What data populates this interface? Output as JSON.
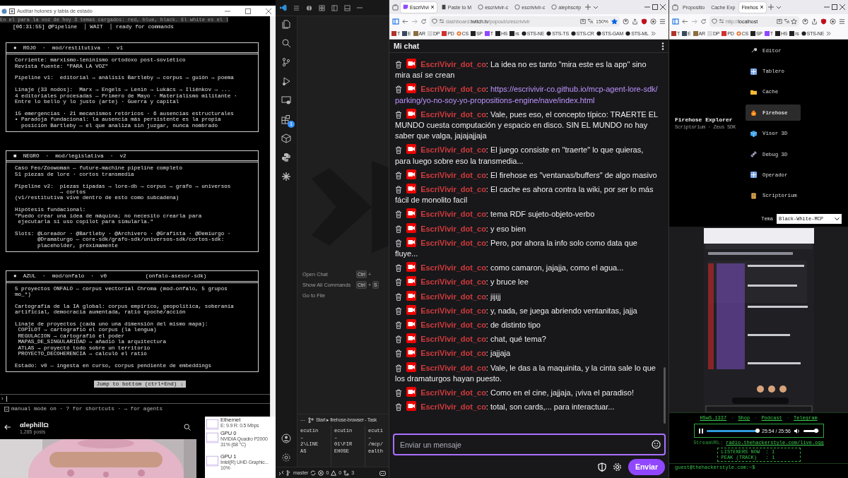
{
  "terminal_window": {
    "title": "Auditar holones y tabla de estado",
    "faded_line": "En el para la voz de hoy 3 temas cargados: red, blue, black. El white es el l",
    "status_line": "[06:31:55] @Pipeline  │ WAIT  │ ready for commands",
    "boxes": [
      {
        "header": "●  ROJO  ·  mod/restitutiva  ·  v1",
        "paragraphs": [
          "Corriente: marxismo-leninismo ortodoxo post-soviético\nRevista fuente: \"PARA LA VOZ\"",
          "Pipeline v1:  editorial → análisis Bartleby → corpus → guión → poema",
          "Linaje (33 nodos):  Marx → Engels → Lenin → Lukács → Iliénkov → ...\n4 editoriales procesadas — Primero de Mayo · Materialismo militante ·\nEntre lo bello y lo justo (arte) · Guerra y capital",
          "15 emergencias · 21 mecanismos retóricos · 6 ausencias estructurales\n▪ Paradoja fundacional: la ausencia más persistente es la propia\n  posición Bartleby — el que analiza sin juzgar, nunca nombrado"
        ]
      },
      {
        "header": "■  NEGRO  ·  mod/legislativa  ·  v2",
        "paragraphs": [
          "Caso Feo/Zoowoman — future-machine pipeline completo\n51 piezas de lore · cortos transmedia",
          "Pipeline v2:  piezas tipadas → lore-db → corpus → grafo → universos\n              → cortos\n(v1/restitutiva vive dentro de esto como subcadena)",
          "Hipótesis fundacional:\n\"Puedo crear una idea de máquina; no necesito crearla para\n ejecutarla si uso copilot para simularla.\"",
          "Slots: @Loreador · @Bartleby · @Archivero · @Grafista · @Demiurgo ·\n       @Dramaturgo — core-sdk/grafo-sdk/universos-sdk/cortos-sdk:\n       placeholder, próximamente"
        ]
      },
      {
        "header": "●  AZUL  ·  mod/onfalo  ·  v0            (onfalo-asesor-sdk)",
        "paragraphs": [
          "5 proyectos ONFALO — corpus vectorial Chroma (mod-onfalo, 5 grupos\nmo_*)",
          "Cartografía de la IA global: corpus empírico, geopolítica, soberanía\nartificial, democracia aumentada, ratio epoché/acción",
          "Linaje de proyectos (cada uno una dimensión del mismo mapa):\n COPILOT → cartografió el corpus (la lengua)\n REGULACION → cartografió el poder\n MAPAS_DE_SINGULARIDAD → añadió la arquitectura\n ATLAS → proyectó todo sobre un territorio\n PROYECTO_DECOHERENCIA → calculó el ratio",
          "Estado: v0 — ingesta en curso, corpus pendiente de embeddings"
        ]
      }
    ],
    "jump_button": "Jump to bottom (ctrl+End) ↓",
    "prompt": "›",
    "footer": "manual mode on · ? for shortcuts · → for agents"
  },
  "social_panel": {
    "name": "αlephillΩ",
    "posts": "1,285 posts",
    "photo": {
      "kind": "picture"
    }
  },
  "task_manager": [
    {
      "name": "Ethernet",
      "detail": "E: 9.9 R: 0.5 Mbps"
    },
    {
      "name": "GPU 0",
      "detail": "NVIDIA Quadro P2000",
      "reading": "31% (68 °C)"
    },
    {
      "name": "GPU 1",
      "detail": "Intel(R) UHD Graphic...",
      "reading": "10%"
    }
  ],
  "code_editor": {
    "extensions_badge": "1",
    "commands": [
      {
        "label": "Open Chat",
        "keys": [
          {
            "kind": "cap",
            "text": "Ctrl"
          },
          {
            "kind": "plus",
            "text": "+"
          }
        ]
      },
      {
        "label": "Show All Commands",
        "keys": [
          {
            "kind": "cap",
            "text": "Ctrl"
          },
          {
            "kind": "plus",
            "text": "+"
          },
          {
            "kind": "cap",
            "text": "S"
          }
        ]
      },
      {
        "label": "Go to File"
      }
    ],
    "panel": {
      "more": "···",
      "breadcrumb": "Start ▸ firehose-browser - Task"
    },
    "terminals": [
      {
        "lines": [
          "ecutin",
          "–",
          "2\\LINE",
          "AS"
        ]
      },
      {
        "lines": [
          "ecutin",
          "–",
          "01\\FIR",
          "EHOSE"
        ]
      },
      {
        "lines": [
          "ecuti",
          "–",
          "/mcp/",
          "ealth"
        ]
      }
    ],
    "status_bar": {
      "branch": "master",
      "errors": "0",
      "warnings": "0",
      "ports": "3"
    }
  },
  "chat_browser": {
    "tabs": [
      {
        "label": "EscriVivi",
        "kind": "twitch",
        "selected": true
      },
      {
        "label": "Paste to M",
        "kind": "page",
        "selected": false
      },
      {
        "label": "escrivivir-c",
        "kind": "github",
        "selected": false
      },
      {
        "label": "escrivivir-c",
        "kind": "github",
        "selected": false
      },
      {
        "label": "alephscrip",
        "kind": "github",
        "selected": false
      }
    ],
    "url": {
      "pre": "dashboard.",
      "host": "twitch.tv",
      "path": "/popout/u/escrivivir"
    },
    "zoom": "150%",
    "bookmarked": true,
    "bookmarks": [
      {
        "label": "T",
        "kind": "square",
        "color": "#b03328"
      },
      {
        "label": "E",
        "kind": "square",
        "color": "#3b4a5a"
      },
      {
        "label": "AR",
        "kind": "square",
        "color": "#8d6e3f"
      },
      {
        "label": "DP",
        "kind": "square",
        "color": "#d8d8d8"
      },
      {
        "label": "PD",
        "kind": "square",
        "color": "#d23030"
      },
      {
        "label": "CS",
        "kind": "round",
        "color": "#e8702a"
      },
      {
        "label": "SP",
        "kind": "square",
        "color": "#222222"
      },
      {
        "label": "T",
        "kind": "square",
        "color": "#9146ff"
      },
      {
        "label": "HS",
        "kind": "square",
        "color": "#222222"
      },
      {
        "label": "rs",
        "kind": "square",
        "color": "#222222"
      },
      {
        "label": "STS-NE",
        "kind": "github",
        "color": "#222222"
      },
      {
        "label": "STS-TS",
        "kind": "github",
        "color": "#222222"
      },
      {
        "label": "STS-CR",
        "kind": "github",
        "color": "#222222"
      },
      {
        "label": "STS-GAM",
        "kind": "github",
        "color": "#222222"
      },
      {
        "label": "STS-ML",
        "kind": "github",
        "color": "#222222"
      }
    ]
  },
  "chat": {
    "title": "Mi chat",
    "separator": ": ",
    "placeholder": "Enviar un mensaje",
    "send": "Enviar",
    "messages": [
      {
        "user": "EscriVivir_dot_co",
        "kind": "text",
        "text": "La idea no es tanto \"mira este es la app\" sino mira así se crean"
      },
      {
        "user": "EscriVivir_dot_co",
        "kind": "link",
        "text": "https://escrivivir-co.github.io/mcp-agent-lore-sdk/parking/yo-no-soy-yo-propositions-engine/nave/index.html"
      },
      {
        "user": "EscriVivir_dot_co",
        "kind": "text",
        "text": "Vale, pues eso, el concepto típico: TRAERTE EL MUNDO cuesta computación y espacio en disco. SIN EL MUNDO no hay saber que valga, jajajajjaja"
      },
      {
        "user": "EscriVivir_dot_co",
        "kind": "text",
        "text": "El juego consiste en \"traerte\" lo que quieras, para luego sobre eso la transmedia..."
      },
      {
        "user": "EscriVivir_dot_co",
        "kind": "text",
        "text": "El firehose es \"ventanas/buffers\" de algo masivo"
      },
      {
        "user": "EscriVivir_dot_co",
        "kind": "text",
        "text": "El cache es ahora contra la wiki, por ser lo más fácil de monolito facil"
      },
      {
        "user": "EscriVivir_dot_co",
        "kind": "text",
        "text": "tema RDF sujeto-objeto-verbo"
      },
      {
        "user": "EscriVivir_dot_co",
        "kind": "text",
        "text": "y eso bien"
      },
      {
        "user": "EscriVivir_dot_co",
        "kind": "text",
        "text": "Pero, por ahora la info solo como data que fluye..."
      },
      {
        "user": "EscriVivir_dot_co",
        "kind": "text",
        "text": "como camaron, jajajja, como el agua..."
      },
      {
        "user": "EscriVivir_dot_co",
        "kind": "text",
        "text": "y bruce lee"
      },
      {
        "user": "EscriVivir_dot_co",
        "kind": "text",
        "text": "jijijj"
      },
      {
        "user": "EscriVivir_dot_co",
        "kind": "text",
        "text": "y, nada, se juega abriendo ventanitas, jajja"
      },
      {
        "user": "EscriVivir_dot_co",
        "kind": "text",
        "text": "de distinto tipo"
      },
      {
        "user": "EscriVivir_dot_co",
        "kind": "text",
        "text": "chat, qué tema?"
      },
      {
        "user": "EscriVivir_dot_co",
        "kind": "text",
        "text": "jajjaja"
      },
      {
        "user": "EscriVivir_dot_co",
        "kind": "text",
        "text": "Vale, le das a la maquinita, y la cinta sale lo que los dramaturgos hayan puesto."
      },
      {
        "user": "EscriVivir_dot_co",
        "kind": "text",
        "text": "Como en el cine, jajjaja, ¡viva el paradiso!"
      },
      {
        "user": "EscriVivir_dot_co",
        "kind": "text",
        "text": "total, son cards,... para interactuar..."
      }
    ]
  },
  "firehose_browser": {
    "tabs": [
      {
        "label": "Propositio",
        "selected": false
      },
      {
        "label": "Cache Exp",
        "selected": false
      },
      {
        "label": "Firehos",
        "selected": true
      }
    ],
    "url": {
      "pre": "http://",
      "host": "localhost"
    },
    "bookmarked": false,
    "bookmarks": [
      {
        "label": "T",
        "kind": "square",
        "color": "#b03328"
      },
      {
        "label": "E",
        "kind": "square",
        "color": "#3b4a5a"
      },
      {
        "label": "AR",
        "kind": "square",
        "color": "#8d6e3f"
      },
      {
        "label": "DP",
        "kind": "square",
        "color": "#d8d8d8"
      },
      {
        "label": "PD",
        "kind": "square",
        "color": "#d23030"
      },
      {
        "label": "CS",
        "kind": "round",
        "color": "#e8702a"
      },
      {
        "label": "SP",
        "kind": "square",
        "color": "#222222"
      },
      {
        "label": "T",
        "kind": "square",
        "color": "#9146ff"
      },
      {
        "label": "HS",
        "kind": "square",
        "color": "#222222"
      },
      {
        "label": "rs",
        "kind": "square",
        "color": "#222222"
      },
      {
        "label": "STS-NE",
        "kind": "github",
        "color": "#222222"
      }
    ]
  },
  "firehose_app": {
    "title": "Firehose Explorer",
    "subtitle": "Scriptorium · Zeus SDK",
    "nav": [
      {
        "label": "Editor",
        "kind": "wrench",
        "selected": false
      },
      {
        "label": "Tablero",
        "kind": "grid",
        "selected": false
      },
      {
        "label": "Cache",
        "kind": "folder",
        "selected": false
      },
      {
        "label": "Firehose",
        "kind": "flame",
        "selected": true
      },
      {
        "label": "Visor 3D",
        "kind": "cube",
        "selected": false
      },
      {
        "label": "Debug 3D",
        "kind": "satellite",
        "selected": false
      },
      {
        "label": "Operador",
        "kind": "grid",
        "selected": false
      },
      {
        "label": "Scriptorium",
        "kind": "scroll",
        "selected": false
      }
    ],
    "theme": {
      "label": "Tema",
      "value": "Black-White-MCP"
    },
    "preview": {
      "kind": "picture"
    },
    "links": [
      "HSwS.1337",
      "Shop",
      "Podcast",
      "Telegram"
    ],
    "link_separator": "·",
    "player": {
      "time": "25:54 / 25:56",
      "progress": {
        "level": 0.98
      },
      "volume": {
        "level": 0.85
      }
    },
    "stream": {
      "label": "StreamURL:",
      "url": "radio.thehackerstyle.com/live.ogg"
    },
    "stats": [
      "LISTENERS NOW  : 1",
      "PEAK (TRACK)   : 1"
    ],
    "prompt": "guest@thehackerstyle.com:~$"
  }
}
